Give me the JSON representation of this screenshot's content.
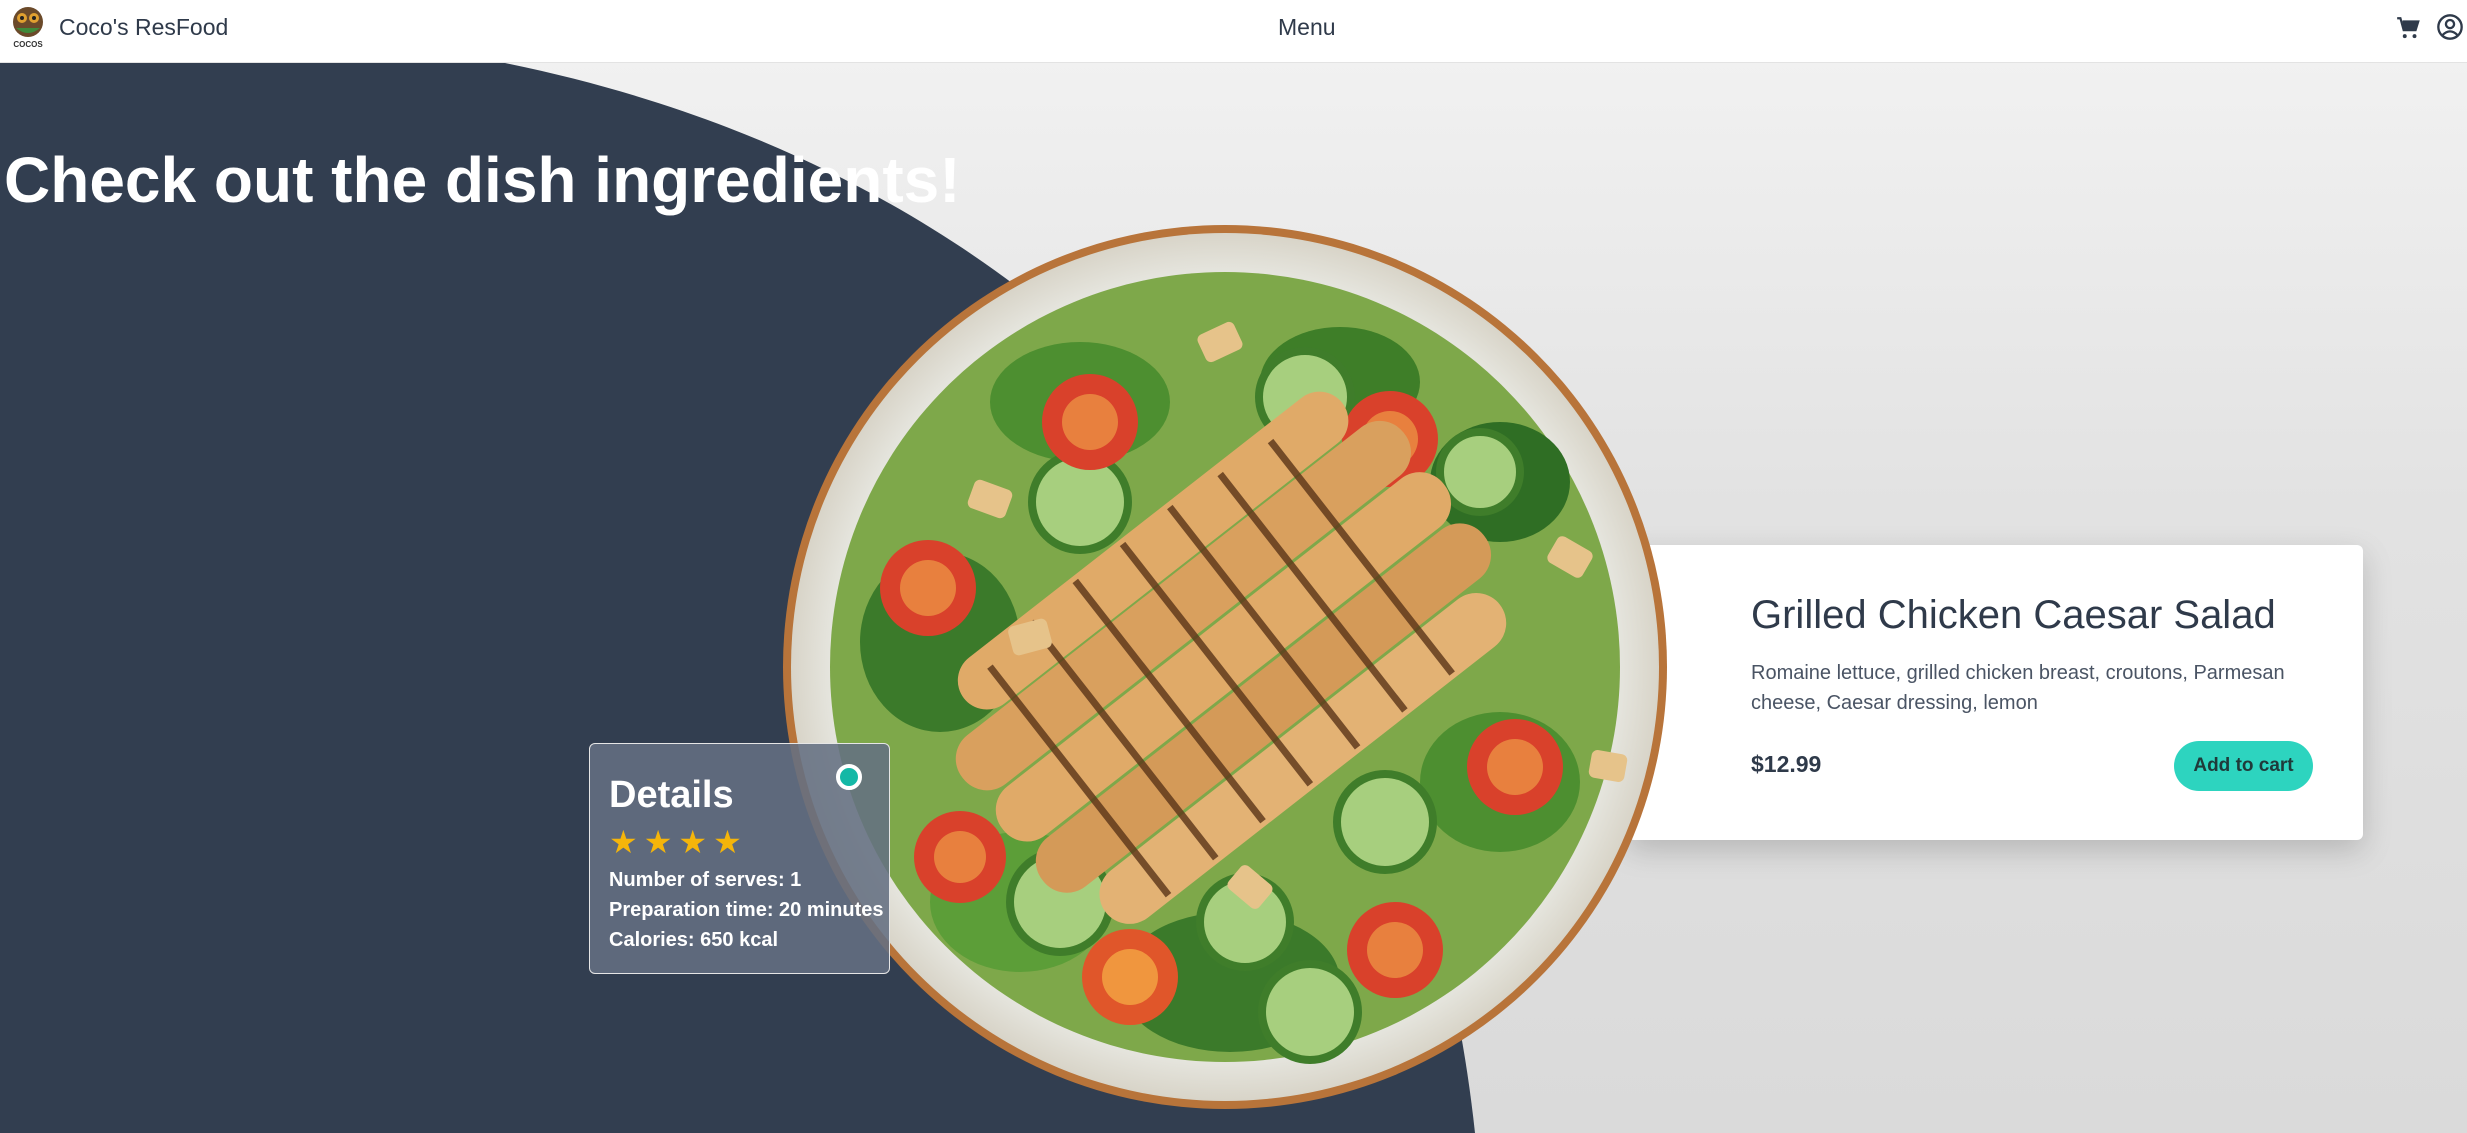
{
  "header": {
    "brand": "Coco's ResFood",
    "logo_text": "COCOS",
    "menu_label": "Menu",
    "cart_icon": "cart-icon",
    "user_icon": "user-circle-icon"
  },
  "hero": {
    "title": "Check out the dish ingredients!"
  },
  "dish": {
    "name": "Grilled Chicken Caesar Salad",
    "description": "Romaine lettuce, grilled chicken breast, croutons, Parmesan cheese, Caesar dressing, lemon",
    "price": "$12.99",
    "add_to_cart_label": "Add to cart"
  },
  "details": {
    "title": "Details",
    "rating": 4,
    "serves": "Number of serves: 1",
    "prep_time": "Preparation time: 20 minutes",
    "calories": "Calories: 650 kcal"
  },
  "colors": {
    "dark_background": "#323e50",
    "accent": "#2dd4bf",
    "star": "#f5b50a"
  }
}
